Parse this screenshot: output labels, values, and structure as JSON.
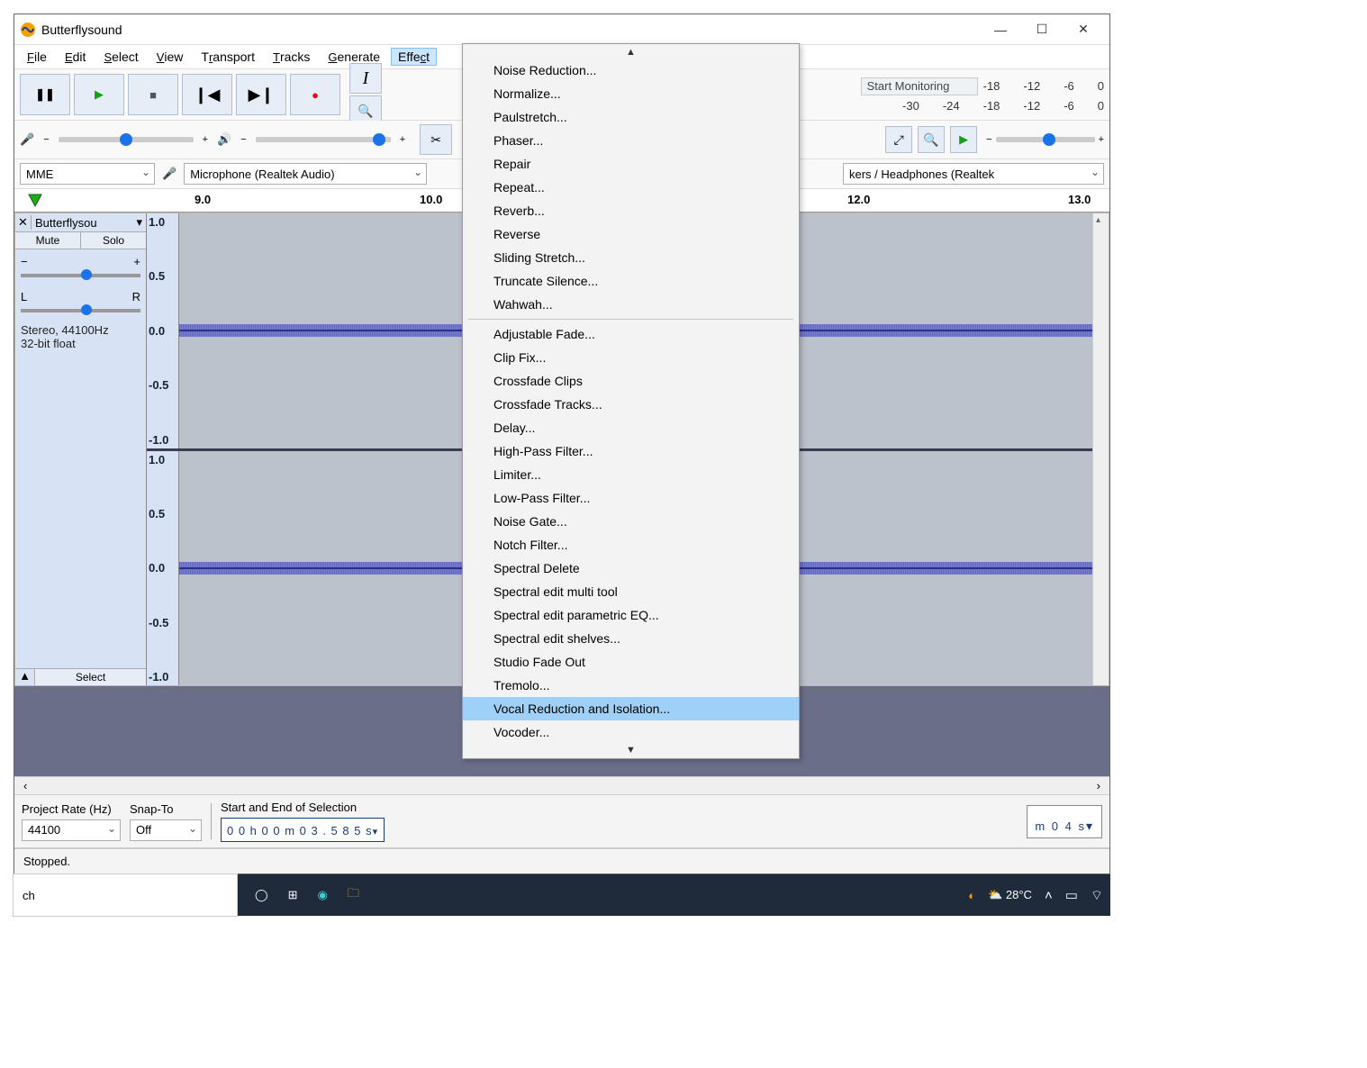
{
  "window": {
    "title": "Butterflysound"
  },
  "menu": {
    "items": [
      "File",
      "Edit",
      "Select",
      "View",
      "Transport",
      "Tracks",
      "Generate",
      "Effect"
    ],
    "active": "Effect"
  },
  "transport": {
    "buttons": [
      "pause",
      "play",
      "stop",
      "skip-start",
      "skip-end",
      "record"
    ]
  },
  "meters": {
    "rec_hint": "Start Monitoring",
    "rec_ticks": [
      "-18",
      "-12",
      "-6",
      "0"
    ],
    "play_ticks": [
      "-30",
      "-24",
      "-18",
      "-12",
      "-6",
      "0"
    ]
  },
  "edit_icons": [
    "text-tool",
    "zoom-tool",
    "cut-tool"
  ],
  "zoom_icons": [
    "zoom-selection",
    "zoom-fit",
    "play-small"
  ],
  "devices": {
    "host": "MME",
    "input": "Microphone (Realtek Audio)",
    "output": "kers / Headphones (Realtek"
  },
  "timeline": {
    "ticks": [
      {
        "label": "9.0",
        "pos": 200
      },
      {
        "label": "10.0",
        "pos": 450
      },
      {
        "label": "12.0",
        "pos": 925
      },
      {
        "label": "13.0",
        "pos": 1175
      }
    ]
  },
  "track": {
    "name": "Butterflysou",
    "mute": "Mute",
    "solo": "Solo",
    "gain_ends": [
      "−",
      "+"
    ],
    "pan_ends": [
      "L",
      "R"
    ],
    "info_line1": "Stereo, 44100Hz",
    "info_line2": "32-bit float",
    "select": "Select",
    "scale": [
      "1.0",
      "0.5",
      "0.0",
      "-0.5",
      "-1.0"
    ]
  },
  "selection": {
    "rate_label": "Project Rate (Hz)",
    "rate_value": "44100",
    "snap_label": "Snap-To",
    "snap_value": "Off",
    "range_label": "Start and End of Selection",
    "start": "0 0 h 0 0 m 0 3 . 5 8 5 s",
    "big_time": "m 0 4 s"
  },
  "status": {
    "text": "Stopped."
  },
  "effect_menu": {
    "group1": [
      "Noise Reduction...",
      "Normalize...",
      "Paulstretch...",
      "Phaser...",
      "Repair",
      "Repeat...",
      "Reverb...",
      "Reverse",
      "Sliding Stretch...",
      "Truncate Silence...",
      "Wahwah..."
    ],
    "group2": [
      "Adjustable Fade...",
      "Clip Fix...",
      "Crossfade Clips",
      "Crossfade Tracks...",
      "Delay...",
      "High-Pass Filter...",
      "Limiter...",
      "Low-Pass Filter...",
      "Noise Gate...",
      "Notch Filter...",
      "Spectral Delete",
      "Spectral edit multi tool",
      "Spectral edit parametric EQ...",
      "Spectral edit shelves...",
      "Studio Fade Out",
      "Tremolo...",
      "Vocal Reduction and Isolation...",
      "Vocoder..."
    ],
    "highlighted": "Vocal Reduction and Isolation..."
  },
  "taskbar": {
    "search_fragment": "ch",
    "temp": "28°C"
  }
}
